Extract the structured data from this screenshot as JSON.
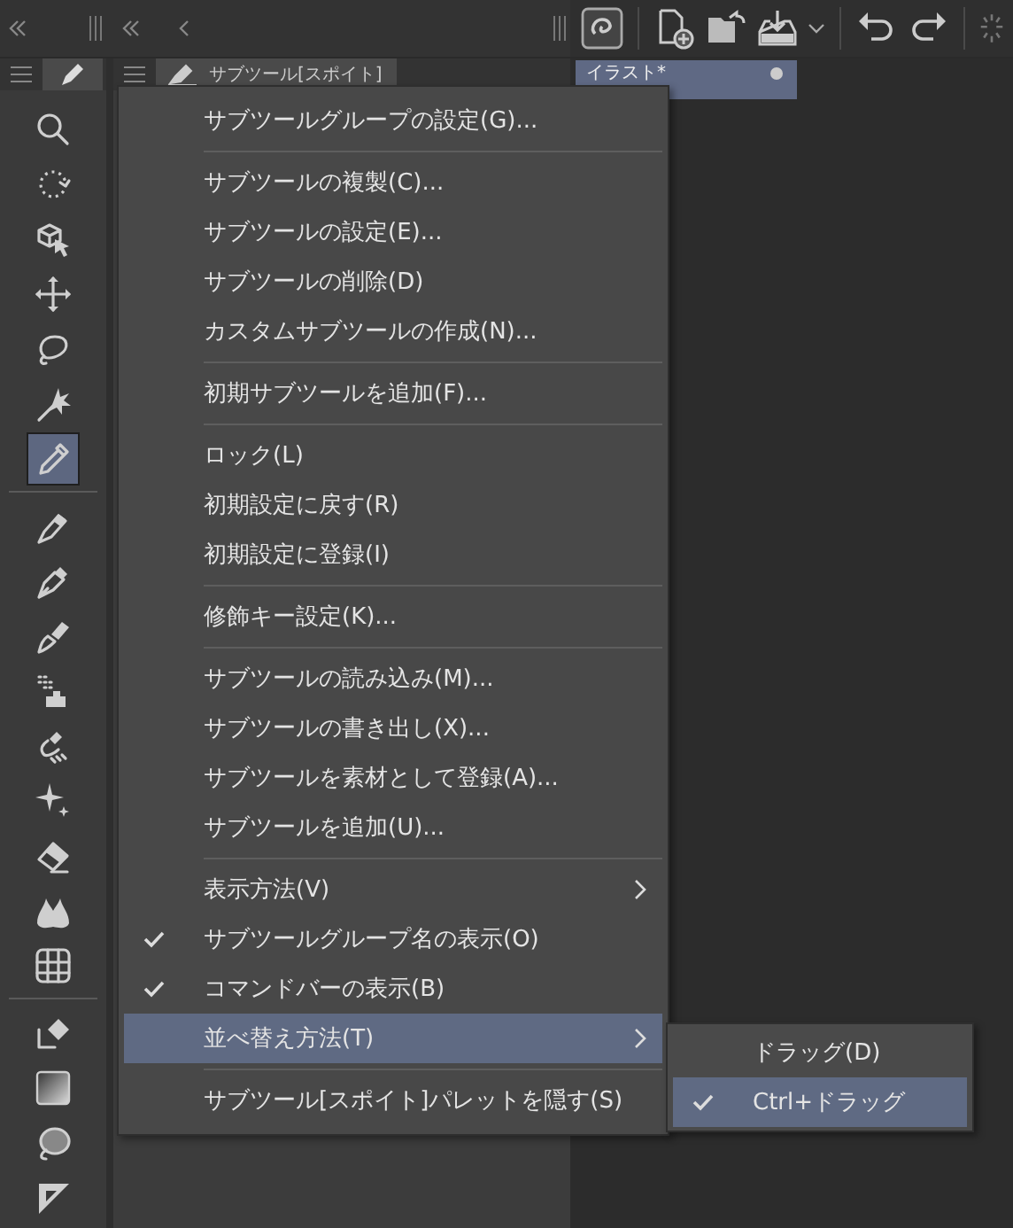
{
  "tool_panel": {
    "tool_groups": [
      {
        "tools": [
          {
            "selected": false
          },
          {
            "selected": false
          },
          {
            "selected": false
          },
          {
            "selected": false
          },
          {
            "selected": false
          },
          {
            "selected": false
          },
          {
            "selected": true
          }
        ]
      },
      {
        "tools": [
          {
            "selected": false
          },
          {
            "selected": false
          },
          {
            "selected": false
          },
          {
            "selected": false
          },
          {
            "selected": false
          },
          {
            "selected": false
          },
          {
            "selected": false
          },
          {
            "selected": false
          },
          {
            "selected": false
          }
        ]
      },
      {
        "tools": [
          {
            "selected": false
          },
          {
            "selected": false
          },
          {
            "selected": false
          },
          {
            "selected": false
          }
        ]
      }
    ]
  },
  "subtool_panel": {
    "tab": {
      "label": "サブツール[スポイト]"
    }
  },
  "canvas": {
    "tab": {
      "title": "イラスト*"
    }
  },
  "context_menu": {
    "items": [
      {
        "kind": "item",
        "label": "サブツールグループの設定(G)...",
        "checked": false,
        "selected": false,
        "submenu": false
      },
      {
        "kind": "separator"
      },
      {
        "kind": "item",
        "label": "サブツールの複製(C)...",
        "checked": false,
        "selected": false,
        "submenu": false
      },
      {
        "kind": "item",
        "label": "サブツールの設定(E)...",
        "checked": false,
        "selected": false,
        "submenu": false
      },
      {
        "kind": "item",
        "label": "サブツールの削除(D)",
        "checked": false,
        "selected": false,
        "submenu": false
      },
      {
        "kind": "item",
        "label": "カスタムサブツールの作成(N)...",
        "checked": false,
        "selected": false,
        "submenu": false
      },
      {
        "kind": "separator"
      },
      {
        "kind": "item",
        "label": "初期サブツールを追加(F)...",
        "checked": false,
        "selected": false,
        "submenu": false
      },
      {
        "kind": "separator"
      },
      {
        "kind": "item",
        "label": "ロック(L)",
        "checked": false,
        "selected": false,
        "submenu": false
      },
      {
        "kind": "item",
        "label": "初期設定に戻す(R)",
        "checked": false,
        "selected": false,
        "submenu": false
      },
      {
        "kind": "item",
        "label": "初期設定に登録(I)",
        "checked": false,
        "selected": false,
        "submenu": false
      },
      {
        "kind": "separator"
      },
      {
        "kind": "item",
        "label": "修飾キー設定(K)...",
        "checked": false,
        "selected": false,
        "submenu": false
      },
      {
        "kind": "separator"
      },
      {
        "kind": "item",
        "label": "サブツールの読み込み(M)...",
        "checked": false,
        "selected": false,
        "submenu": false
      },
      {
        "kind": "item",
        "label": "サブツールの書き出し(X)...",
        "checked": false,
        "selected": false,
        "submenu": false
      },
      {
        "kind": "item",
        "label": "サブツールを素材として登録(A)...",
        "checked": false,
        "selected": false,
        "submenu": false
      },
      {
        "kind": "item",
        "label": "サブツールを追加(U)...",
        "checked": false,
        "selected": false,
        "submenu": false
      },
      {
        "kind": "separator"
      },
      {
        "kind": "item",
        "label": "表示方法(V)",
        "checked": false,
        "selected": false,
        "submenu": true
      },
      {
        "kind": "item",
        "label": "サブツールグループ名の表示(O)",
        "checked": true,
        "selected": false,
        "submenu": false
      },
      {
        "kind": "item",
        "label": "コマンドバーの表示(B)",
        "checked": true,
        "selected": false,
        "submenu": false
      },
      {
        "kind": "item",
        "label": "並べ替え方法(T)",
        "checked": false,
        "selected": true,
        "submenu": true
      },
      {
        "kind": "separator"
      },
      {
        "kind": "item",
        "label": "サブツール[スポイト]パレットを隠す(S)",
        "checked": false,
        "selected": false,
        "submenu": false
      }
    ]
  },
  "submenu": {
    "items": [
      {
        "label": "ドラッグ(D)",
        "checked": false,
        "selected": false
      },
      {
        "label": "Ctrl+ドラッグ",
        "checked": true,
        "selected": true
      }
    ]
  }
}
